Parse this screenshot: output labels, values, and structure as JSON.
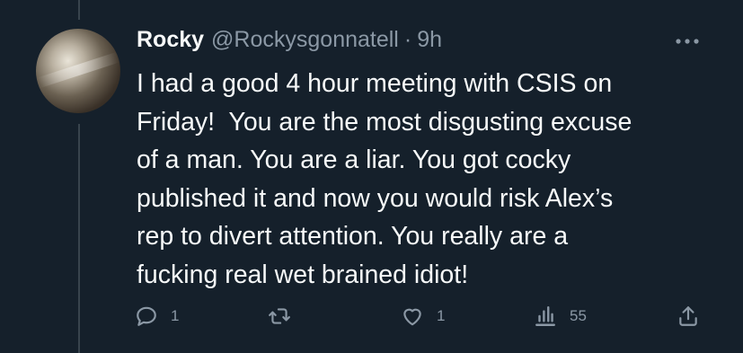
{
  "tweet": {
    "author_name": "Rocky",
    "author_handle": "@Rockysgonnatell",
    "separator": "·",
    "time": "9h",
    "text": "I had a good 4 hour meeting with CSIS on\nFriday!  You are the most disgusting excuse\nof a man. You are a liar. You got cocky\npublished it and now you would risk Alex’s\nrep to divert attention. You really are a\nfucking real wet brained idiot!",
    "more_icon": "more-horizontal-icon"
  },
  "actions": {
    "reply": {
      "icon": "reply-icon",
      "count": "1"
    },
    "retweet": {
      "icon": "retweet-icon",
      "count": ""
    },
    "like": {
      "icon": "heart-icon",
      "count": "1"
    },
    "views": {
      "icon": "views-icon",
      "count": "55"
    },
    "share": {
      "icon": "share-icon",
      "count": ""
    }
  },
  "colors": {
    "background": "#15202b",
    "text": "#f7f9f9",
    "muted": "#8b98a5",
    "thread_line": "#38444d"
  }
}
